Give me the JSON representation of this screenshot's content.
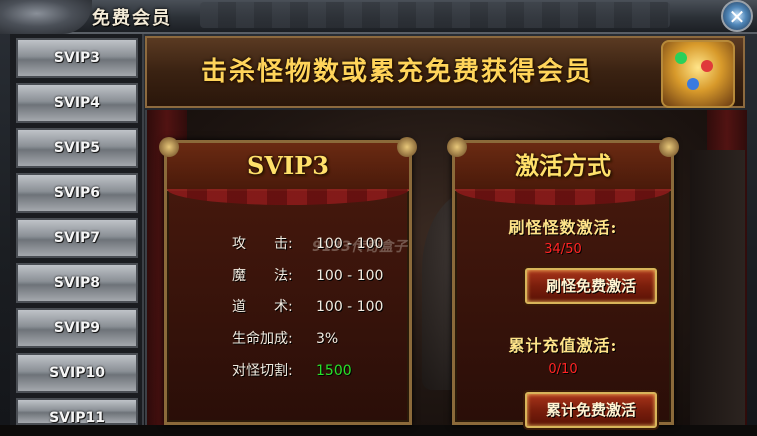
{
  "window": {
    "title": "免费会员",
    "close_label": "✕"
  },
  "sidebar": {
    "items": [
      {
        "label": "SVIP3"
      },
      {
        "label": "SVIP4"
      },
      {
        "label": "SVIP5"
      },
      {
        "label": "SVIP6"
      },
      {
        "label": "SVIP7"
      },
      {
        "label": "SVIP8"
      },
      {
        "label": "SVIP9"
      },
      {
        "label": "SVIP10"
      },
      {
        "label": "SVIP11"
      }
    ]
  },
  "banner": {
    "text": "击杀怪物数或累充免费获得会员"
  },
  "detail": {
    "title": "SVIP3",
    "stats": [
      {
        "label": "攻　　击:",
        "value": "100 - 100"
      },
      {
        "label": "魔　　法:",
        "value": "100 - 100"
      },
      {
        "label": "道　　术:",
        "value": "100 - 100"
      },
      {
        "label": "生命加成:",
        "value": "3%"
      },
      {
        "label": "对怪切割:",
        "value": "1500"
      }
    ],
    "watermark": "9133传奇盒子"
  },
  "activation": {
    "title": "激活方式",
    "kill": {
      "label": "刷怪怪数激活:",
      "progress": "34/50",
      "button": "刷怪免费激活"
    },
    "recharge": {
      "label": "累计充值激活:",
      "progress": "0/10",
      "button": "累计免费激活"
    }
  },
  "colors": {
    "highlight_value": "#28e12a",
    "progress_text": "#ff2424",
    "gold_title": "#ffe06a"
  }
}
